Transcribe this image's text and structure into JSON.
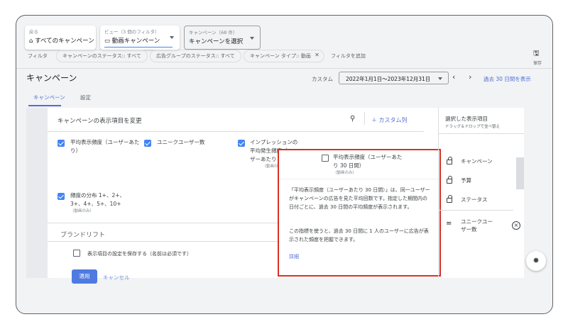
{
  "top": {
    "back_label": "戻る",
    "back_value": "すべてのキャンペーン",
    "view_label": "ビュー（3 個のフィルタ）",
    "view_value": "動画キャンペーン",
    "campaign_label": "キャンペーン（68 件）",
    "campaign_value": "キャンペーンを選択",
    "save": "保存"
  },
  "filters": {
    "label": "フィルタ",
    "chips": [
      "キャンペーンのステータス:: すべて",
      "広告グループのステータス:: すべて",
      "キャンペーン タイプ:: 動画"
    ],
    "add": "フィルタを追加"
  },
  "header": {
    "title": "キャンペーン",
    "range_label": "カスタム",
    "range_value": "2022年1月1日～2023年12月31日",
    "last30": "過去 30 日間を表示"
  },
  "tabs": [
    "キャンペーン",
    "設定"
  ],
  "panel": {
    "title": "キャンペーンの表示項目を変更",
    "custom_col": "カスタム列",
    "items": [
      {
        "label": "平均表示頻度（ユーザーあたり）",
        "checked": true
      },
      {
        "label": "ユニークユーザー数",
        "checked": true
      },
      {
        "label": "インプレッションの平均発生頻度（ユーザーあたり 7 日間）",
        "note": "（動画のみ）",
        "checked": true
      },
      {
        "label": "平均表示頻度（ユーザーあたり 30 日間）",
        "note": "（動画のみ）",
        "checked": false
      },
      {
        "label": "頻度の分布 1+、2+、3+、4+、5+、10+",
        "note": "（動画のみ）",
        "checked": true
      }
    ],
    "section2": "ブランドリフト",
    "save_setting": "表示項目の設定を保存する（名前は必須です）",
    "apply": "適用",
    "cancel": "キャンセル"
  },
  "tooltip": {
    "p1": "「平均表示頻度（ユーザーあたり 30 日間）」は、同一ユーザーがキャンペーンの広告を見た平均回数です。指定した期間内の日付ごとに、過去 30 日間の平均頻度が表示されます。",
    "p2": "この指標を使うと、過去 30 日間に 1 人のユーザーに広告が表示された頻度を把握できます。",
    "link": "詳細"
  },
  "selected": {
    "title": "選択した表示項目",
    "sub": "ドラッグ＆ドロップで並べ替え",
    "locked": [
      "キャンペーン",
      "予算",
      "ステータス"
    ],
    "movable": [
      "ユニークユーザー数"
    ]
  },
  "colors": {
    "accent": "#4285f4",
    "highlight": "#d93025"
  }
}
